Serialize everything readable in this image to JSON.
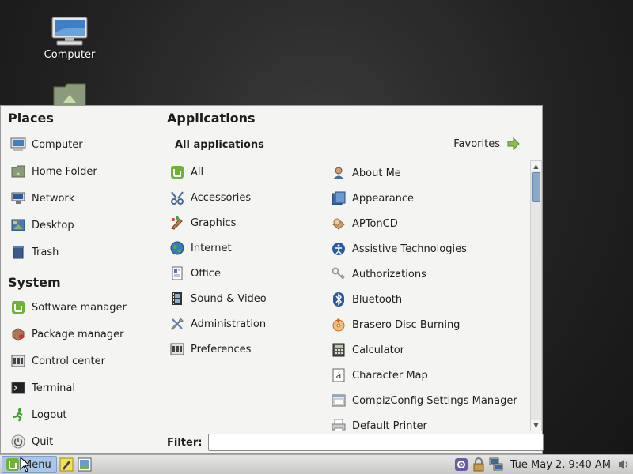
{
  "desktop": {
    "icons": [
      {
        "label": "Computer",
        "icon": "computer-icon"
      },
      {
        "label": "",
        "icon": "home-folder-icon"
      }
    ]
  },
  "menu": {
    "places_title": "Places",
    "places": [
      {
        "label": "Computer",
        "icon": "computer-icon"
      },
      {
        "label": "Home Folder",
        "icon": "home-folder-icon"
      },
      {
        "label": "Network",
        "icon": "network-icon"
      },
      {
        "label": "Desktop",
        "icon": "desktop-icon"
      },
      {
        "label": "Trash",
        "icon": "trash-icon"
      }
    ],
    "system_title": "System",
    "system": [
      {
        "label": "Software manager",
        "icon": "mint-logo-icon"
      },
      {
        "label": "Package manager",
        "icon": "package-icon"
      },
      {
        "label": "Control center",
        "icon": "control-center-icon"
      },
      {
        "label": "Terminal",
        "icon": "terminal-icon"
      },
      {
        "label": "Logout",
        "icon": "logout-icon"
      },
      {
        "label": "Quit",
        "icon": "power-icon"
      }
    ],
    "applications_title": "Applications",
    "all_applications_label": "All applications",
    "favorites_label": "Favorites",
    "categories": [
      {
        "label": "All",
        "icon": "mint-logo-icon"
      },
      {
        "label": "Accessories",
        "icon": "accessories-icon"
      },
      {
        "label": "Graphics",
        "icon": "graphics-icon"
      },
      {
        "label": "Internet",
        "icon": "globe-icon"
      },
      {
        "label": "Office",
        "icon": "office-icon"
      },
      {
        "label": "Sound & Video",
        "icon": "film-icon"
      },
      {
        "label": "Administration",
        "icon": "tools-icon"
      },
      {
        "label": "Preferences",
        "icon": "preferences-icon"
      }
    ],
    "apps": [
      {
        "label": "About Me",
        "icon": "user-icon"
      },
      {
        "label": "Appearance",
        "icon": "appearance-icon"
      },
      {
        "label": "APTonCD",
        "icon": "cd-icon"
      },
      {
        "label": "Assistive Technologies",
        "icon": "accessibility-icon"
      },
      {
        "label": "Authorizations",
        "icon": "keys-icon"
      },
      {
        "label": "Bluetooth",
        "icon": "bluetooth-icon"
      },
      {
        "label": "Brasero Disc Burning",
        "icon": "disc-burn-icon"
      },
      {
        "label": "Calculator",
        "icon": "calculator-icon"
      },
      {
        "label": "Character Map",
        "icon": "character-map-icon"
      },
      {
        "label": "CompizConfig Settings Manager",
        "icon": "compiz-icon"
      },
      {
        "label": "Default Printer",
        "icon": "printer-icon"
      }
    ],
    "filter_label": "Filter:",
    "filter_value": ""
  },
  "taskbar": {
    "menu_label": "Menu",
    "clock": "Tue May  2,  9:40 AM"
  },
  "colors": {
    "menu_bg": "#f4f4f2",
    "accent": "#a9c6e6",
    "mint_green": "#6fb23a"
  }
}
